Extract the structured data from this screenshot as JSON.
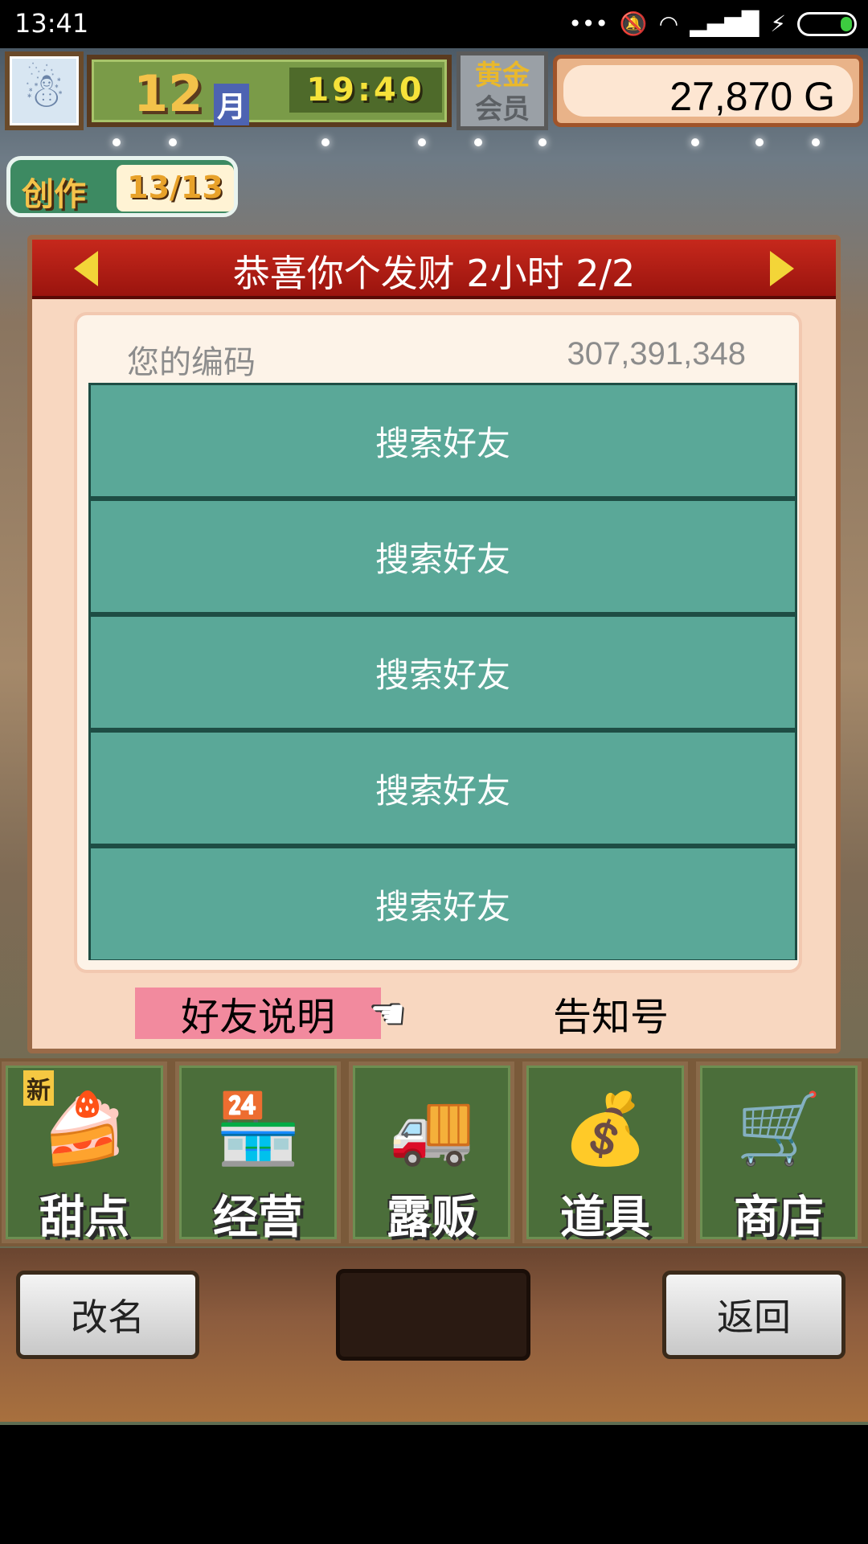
{
  "status_bar": {
    "time": "13:41",
    "icons": [
      "more-dots-icon",
      "mute-bell-icon",
      "wifi-icon",
      "signal-icon",
      "charging-icon",
      "battery-icon"
    ],
    "battery_color": "#3dcc40"
  },
  "hud": {
    "month_number": "12",
    "month_label": "月",
    "clock": "19:40",
    "vip_line1": "黄金",
    "vip_line2": "会员",
    "gold": "27,870 G"
  },
  "create_badge": {
    "label": "创作",
    "count": "13/13"
  },
  "dialog": {
    "title": "恭喜你个发财  2小时 2/2",
    "code_label": "您的编码",
    "code_value": "307,391,348",
    "friend_rows": [
      "搜索好友",
      "搜索好友",
      "搜索好友",
      "搜索好友",
      "搜索好友"
    ],
    "help_label": "好友说明",
    "notice_label": "告知号"
  },
  "menu": {
    "new_badge": "新",
    "items": [
      {
        "label": "甜点",
        "icon": "cake-icon"
      },
      {
        "label": "经营",
        "icon": "shop-building-icon"
      },
      {
        "label": "露贩",
        "icon": "food-truck-icon"
      },
      {
        "label": "道具",
        "icon": "item-bag-icon"
      },
      {
        "label": "商店",
        "icon": "shopping-cart-icon"
      }
    ]
  },
  "bottom_bar": {
    "rename_label": "改名",
    "back_label": "返回"
  },
  "colors": {
    "dialog_header": "#c6281c",
    "friend_row": "#5aa898",
    "help_button": "#f28a9e",
    "menu_tile": "#4b6e3a"
  }
}
